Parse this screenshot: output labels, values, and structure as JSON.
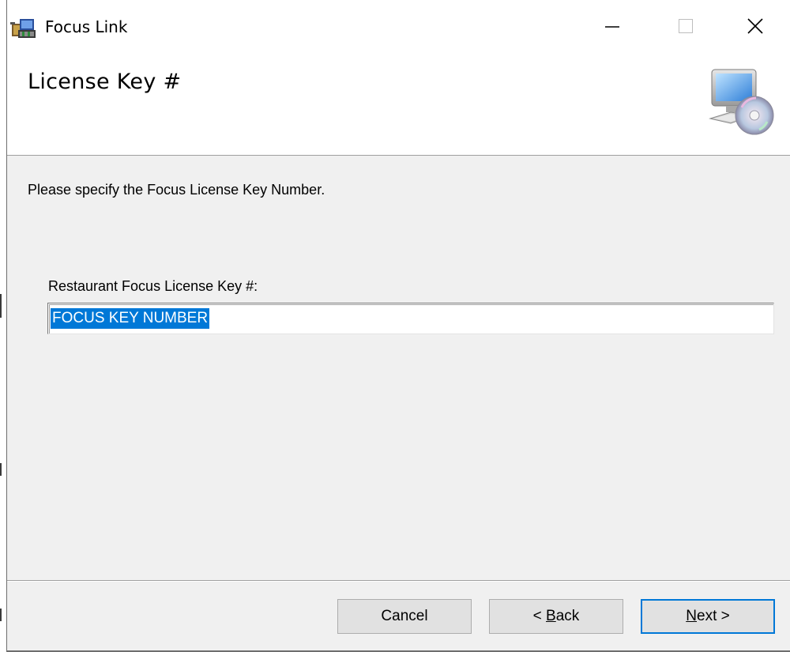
{
  "window": {
    "title": "Focus Link",
    "controls": {
      "minimize": "minimize",
      "maximize": "maximize",
      "close": "close"
    }
  },
  "banner": {
    "title": "License Key #",
    "icon": "computer-with-cd-icon"
  },
  "body": {
    "instruction": "Please specify the Focus License Key Number.",
    "field": {
      "label": "Restaurant Focus License Key #:",
      "value": "FOCUS KEY NUMBER",
      "selected": true
    }
  },
  "footer": {
    "cancel_label": "Cancel",
    "back": {
      "prefix": "< ",
      "mnemonic": "B",
      "rest": "ack"
    },
    "next": {
      "mnemonic": "N",
      "rest": "ext >"
    }
  },
  "colors": {
    "selection": "#0078d7",
    "face": "#f0f0f0",
    "default_button_border": "#0078d7"
  }
}
